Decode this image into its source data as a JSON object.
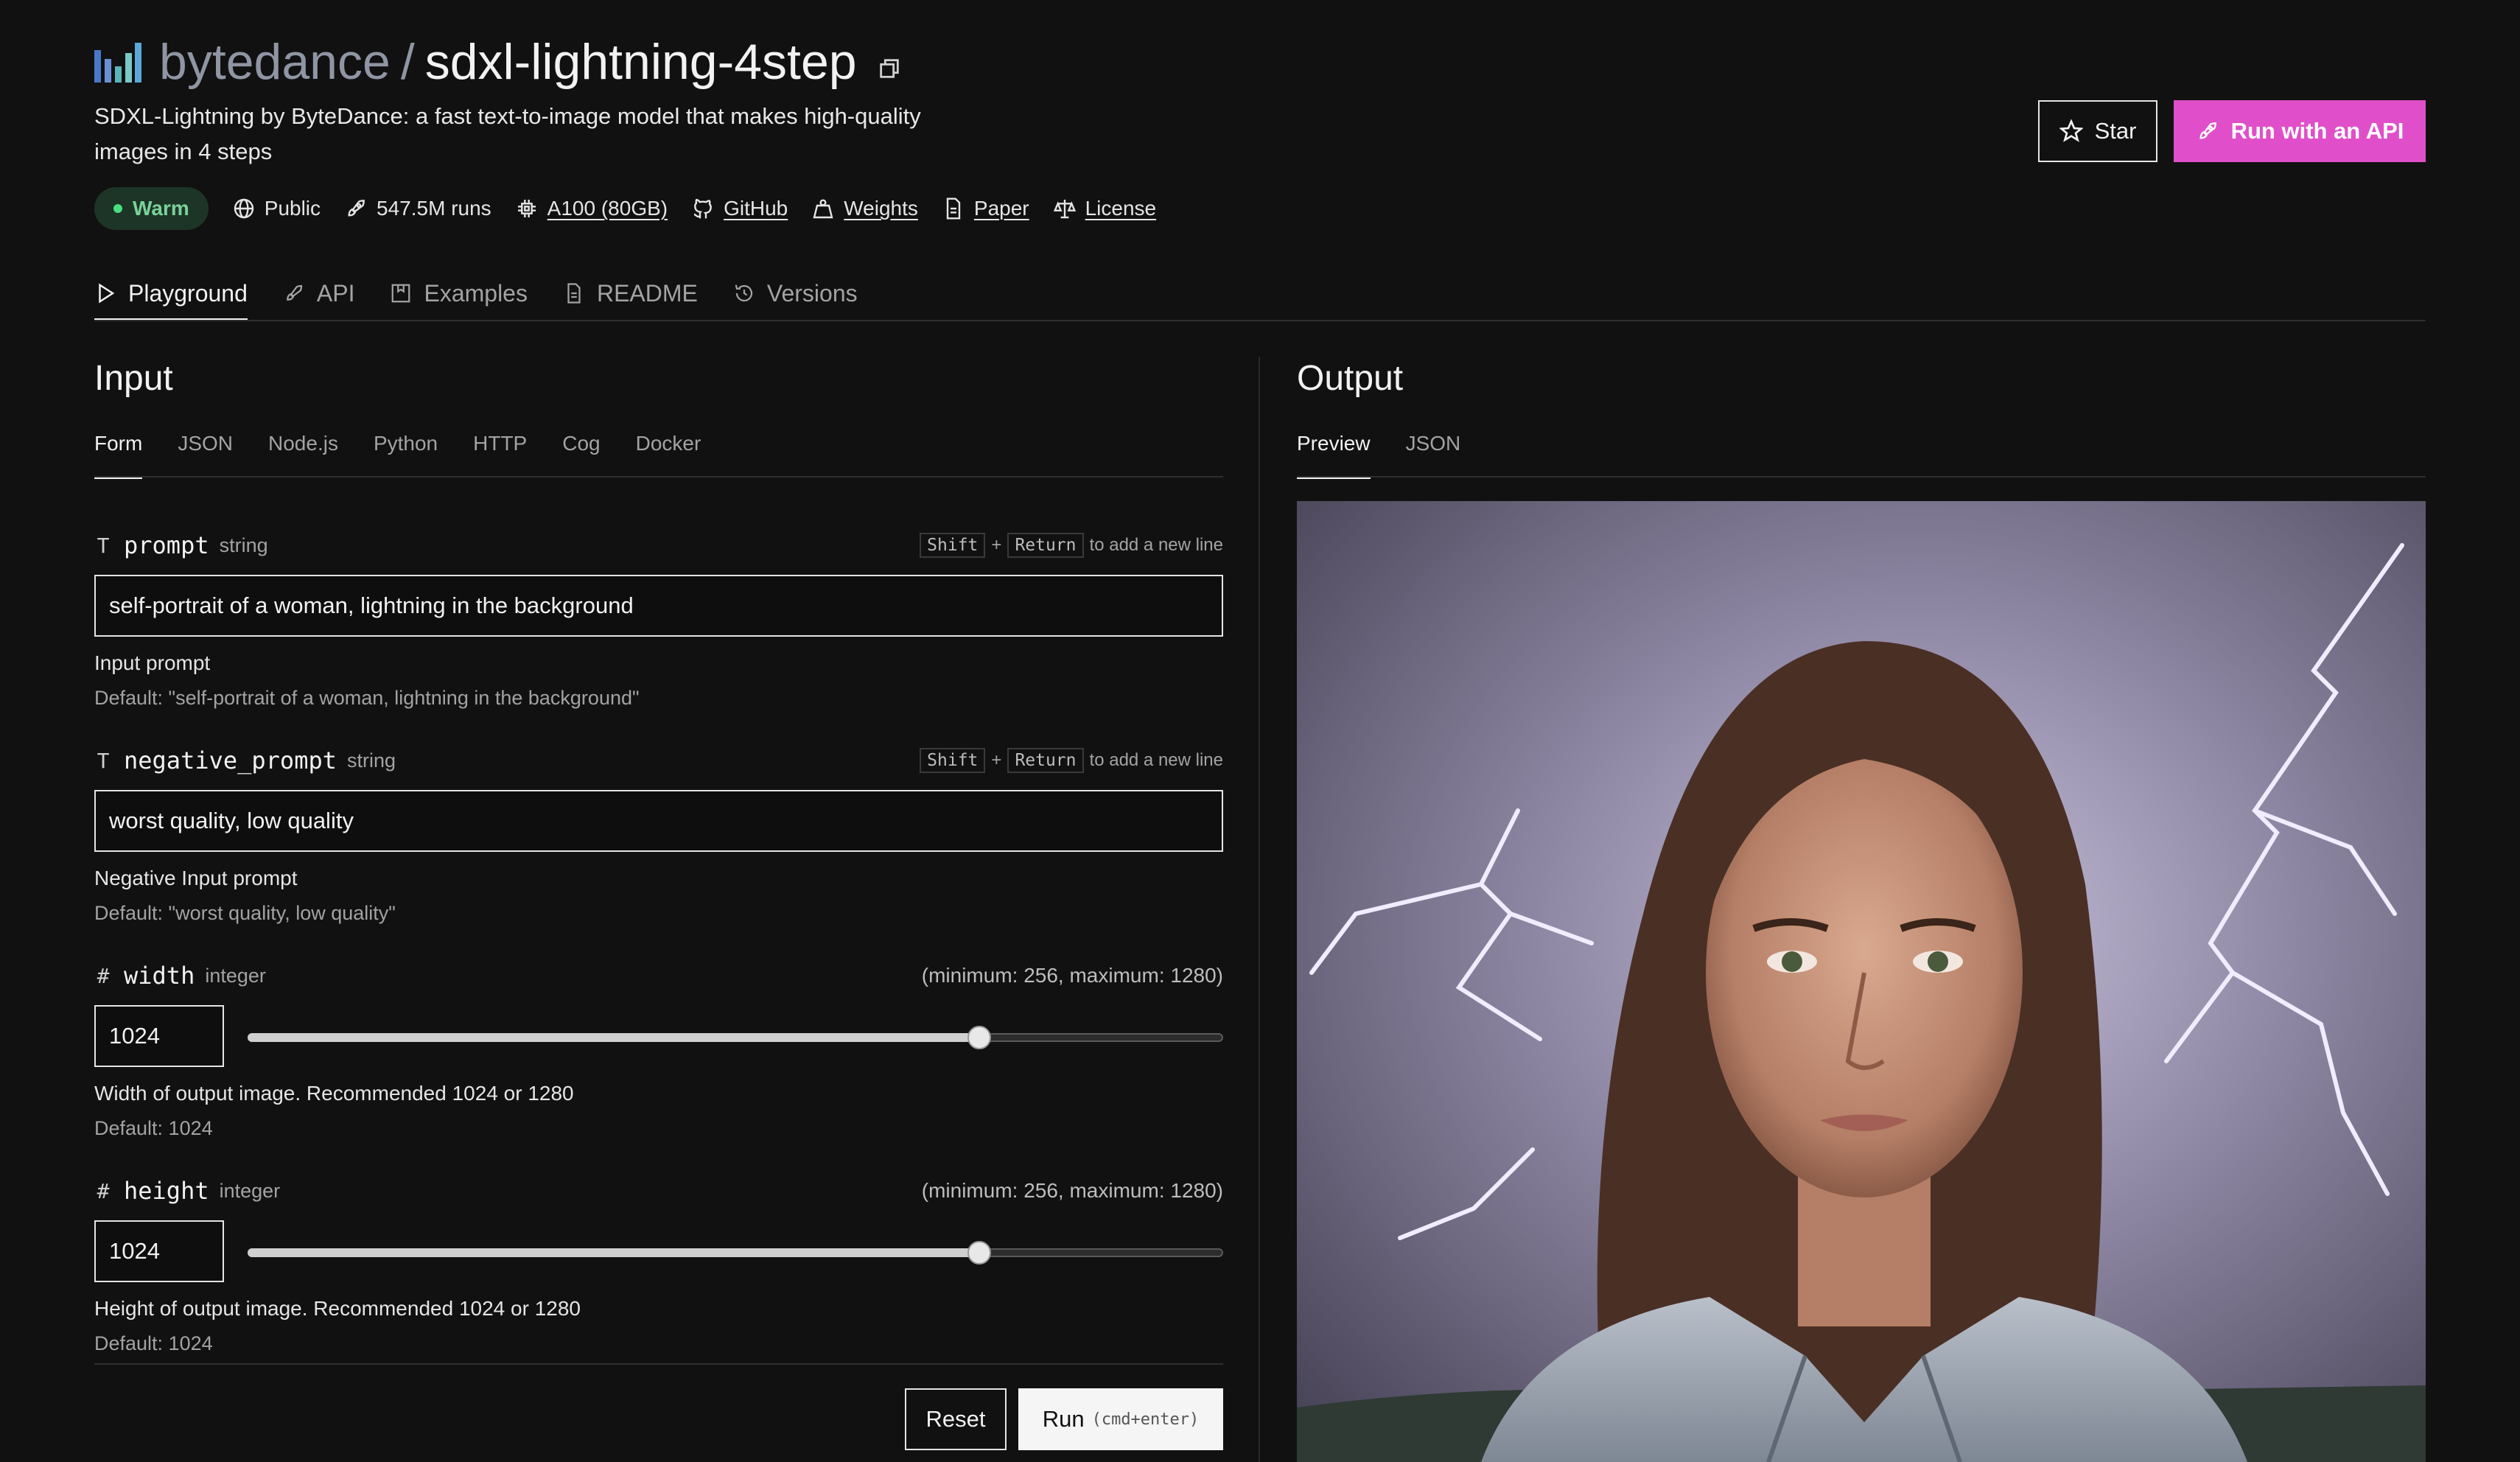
{
  "header": {
    "owner": "bytedance",
    "separator": "/",
    "model": "sdxl-lightning-4step",
    "description": "SDXL-Lightning by ByteDance: a fast text-to-image model that makes high-quality images in 4 steps"
  },
  "meta": {
    "status": "Warm",
    "visibility": "Public",
    "runs": "547.5M runs",
    "hardware": "A100 (80GB)",
    "github": "GitHub",
    "weights": "Weights",
    "paper": "Paper",
    "license": "License"
  },
  "actions": {
    "star": "Star",
    "run_api": "Run with an API"
  },
  "tabs": [
    "Playground",
    "API",
    "Examples",
    "README",
    "Versions"
  ],
  "input": {
    "heading": "Input",
    "subtabs": [
      "Form",
      "JSON",
      "Node.js",
      "Python",
      "HTTP",
      "Cog",
      "Docker"
    ],
    "newline_hint": {
      "key1": "Shift",
      "plus": "+",
      "key2": "Return",
      "text": "to add a new line"
    },
    "prompt": {
      "type_icon": "T",
      "name": "prompt",
      "kind": "string",
      "value": "self-portrait of a woman, lightning in the background",
      "description": "Input prompt",
      "default": "Default: \"self-portrait of a woman, lightning in the background\""
    },
    "negative_prompt": {
      "type_icon": "T",
      "name": "negative_prompt",
      "kind": "string",
      "value": "worst quality, low quality",
      "description": "Negative Input prompt",
      "default": "Default: \"worst quality, low quality\""
    },
    "width": {
      "type_icon": "#",
      "name": "width",
      "kind": "integer",
      "range": "(minimum: 256, maximum: 1280)",
      "value": "1024",
      "min": 256,
      "max": 1280,
      "number": 1024,
      "description": "Width of output image. Recommended 1024 or 1280",
      "default": "Default: 1024"
    },
    "height": {
      "type_icon": "#",
      "name": "height",
      "kind": "integer",
      "range": "(minimum: 256, maximum: 1280)",
      "value": "1024",
      "min": 256,
      "max": 1280,
      "number": 1024,
      "description": "Height of output image. Recommended 1024 or 1280",
      "default": "Default: 1024"
    },
    "reset": "Reset",
    "run": "Run",
    "run_shortcut": "(cmd+enter)"
  },
  "output": {
    "heading": "Output",
    "subtabs": [
      "Preview",
      "JSON"
    ]
  },
  "colors": {
    "accent": "#e04fc9",
    "warm_bg": "#1c3526",
    "warm_text": "#7bd19a",
    "background": "#111111"
  }
}
